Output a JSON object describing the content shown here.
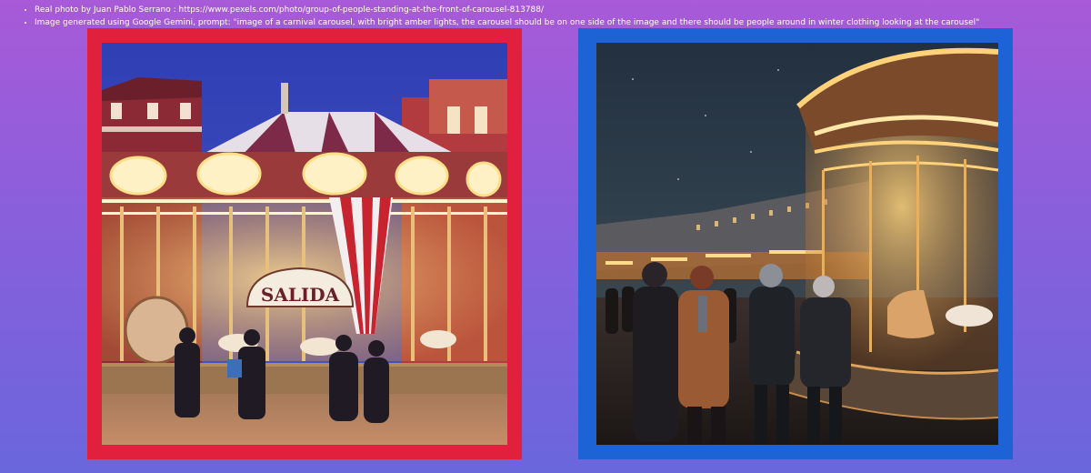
{
  "captions": {
    "line1": "Real photo by Juan Pablo Serrano : https://www.pexels.com/photo/group-of-people-standing-at-the-front-of-carousel-813788/",
    "line2": "Image generated using Google Gemini, prompt: \"image of a carnival carousel, with bright amber lights, the carousel should be on one side of the image and there should be people around in winter clothing looking at the carousel\""
  },
  "left_photo": {
    "sign_text": "SALIDA",
    "frame_color": "#e0203c"
  },
  "right_photo": {
    "frame_color": "#1e63d6"
  },
  "colors": {
    "amber": "#f5c46a",
    "night_sky_left": "#2c3fb0",
    "night_sky_right": "#1f2c38"
  }
}
